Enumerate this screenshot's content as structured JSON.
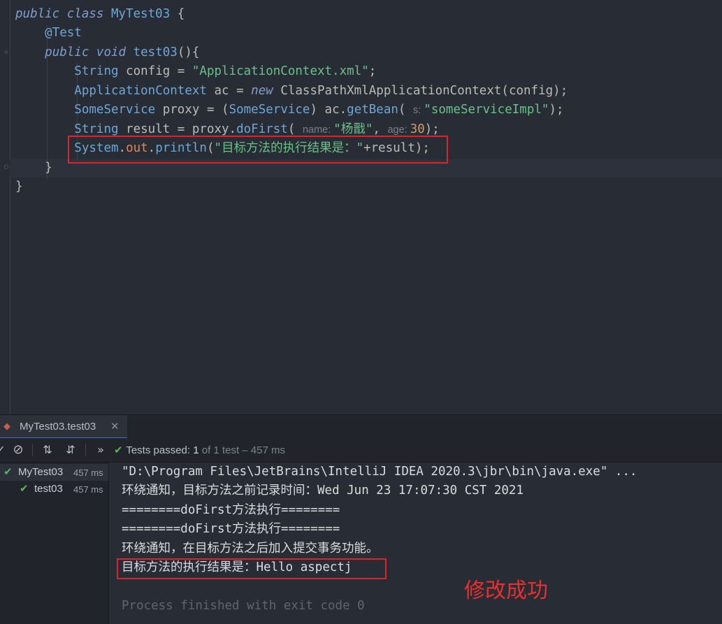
{
  "editor": {
    "lines": [
      {
        "segments": [
          {
            "t": "public class ",
            "c": "kw-i"
          },
          {
            "t": "MyTest03",
            "c": "cls"
          },
          {
            "t": " {",
            "c": "txt"
          }
        ]
      },
      {
        "segments": [
          {
            "t": "    ",
            "c": "txt"
          },
          {
            "t": "@Test",
            "c": "ann"
          }
        ]
      },
      {
        "segments": [
          {
            "t": "    ",
            "c": "txt"
          },
          {
            "t": "public void ",
            "c": "kw-i"
          },
          {
            "t": "test03",
            "c": "fn"
          },
          {
            "t": "(){",
            "c": "txt"
          }
        ]
      },
      {
        "segments": [
          {
            "t": "        ",
            "c": "txt"
          },
          {
            "t": "String",
            "c": "cls"
          },
          {
            "t": " config = ",
            "c": "txt"
          },
          {
            "t": "\"ApplicationContext.xml\"",
            "c": "str"
          },
          {
            "t": ";",
            "c": "txt"
          }
        ]
      },
      {
        "segments": [
          {
            "t": "        ",
            "c": "txt"
          },
          {
            "t": "ApplicationContext",
            "c": "cls"
          },
          {
            "t": " ac = ",
            "c": "txt"
          },
          {
            "t": "new ",
            "c": "kw-i"
          },
          {
            "t": "ClassPathXmlApplicationContext(config);",
            "c": "txt"
          }
        ]
      },
      {
        "segments": [
          {
            "t": "        ",
            "c": "txt"
          },
          {
            "t": "SomeService",
            "c": "cls"
          },
          {
            "t": " proxy = (",
            "c": "txt"
          },
          {
            "t": "SomeService",
            "c": "cls"
          },
          {
            "t": ") ac.",
            "c": "txt"
          },
          {
            "t": "getBean",
            "c": "fn"
          },
          {
            "t": "( ",
            "c": "txt"
          },
          {
            "t": "s: ",
            "c": "hint"
          },
          {
            "t": "\"someServiceImpl\"",
            "c": "str"
          },
          {
            "t": ");",
            "c": "txt"
          }
        ]
      },
      {
        "segments": [
          {
            "t": "        ",
            "c": "txt"
          },
          {
            "t": "String",
            "c": "cls"
          },
          {
            "t": " result = proxy.",
            "c": "txt"
          },
          {
            "t": "doFirst",
            "c": "fn"
          },
          {
            "t": "( ",
            "c": "txt"
          },
          {
            "t": "name: ",
            "c": "hint"
          },
          {
            "t": "\"杨戬\"",
            "c": "str"
          },
          {
            "t": ", ",
            "c": "txt"
          },
          {
            "t": "age: ",
            "c": "hint"
          },
          {
            "t": "30",
            "c": "num"
          },
          {
            "t": ");",
            "c": "txt"
          }
        ]
      },
      {
        "segments": [
          {
            "t": "        ",
            "c": "txt"
          },
          {
            "t": "System",
            "c": "cls"
          },
          {
            "t": ".",
            "c": "txt"
          },
          {
            "t": "out",
            "c": "field"
          },
          {
            "t": ".",
            "c": "txt"
          },
          {
            "t": "println",
            "c": "fn"
          },
          {
            "t": "(",
            "c": "txt"
          },
          {
            "t": "\"目标方法的执行结果是：\"",
            "c": "str"
          },
          {
            "t": "+result);",
            "c": "txt"
          }
        ]
      },
      {
        "segments": [
          {
            "t": "    }",
            "c": "txt"
          }
        ]
      },
      {
        "segments": [
          {
            "t": "}",
            "c": "txt"
          }
        ]
      }
    ]
  },
  "run_panel": {
    "tab_label": "MyTest03.test03",
    "tab_icon": "run-config-icon",
    "close_icon": "close-icon",
    "status": {
      "label": "Tests passed: ",
      "count": "1",
      "detail": " of 1 test – 457 ms"
    },
    "tree": [
      {
        "label": "MyTest03",
        "time": "457 ms"
      },
      {
        "label": "test03",
        "time": "457 ms"
      }
    ],
    "console_lines": [
      "\"D:\\Program Files\\JetBrains\\IntelliJ IDEA 2020.3\\jbr\\bin\\java.exe\" ...",
      "环绕通知，目标方法之前记录时间：Wed Jun 23 17:07:30 CST 2021",
      "========doFirst方法执行========",
      "========doFirst方法执行========",
      "环绕通知，在目标方法之后加入提交事务功能。",
      "目标方法的执行结果是：Hello aspectj",
      "",
      "Process finished with exit code 0"
    ]
  },
  "annotation_note": "修改成功",
  "colors": {
    "background": "#282c34",
    "highlight_box": "#d9262e",
    "pass_green": "#5db35a",
    "note_red": "#e8302e"
  }
}
